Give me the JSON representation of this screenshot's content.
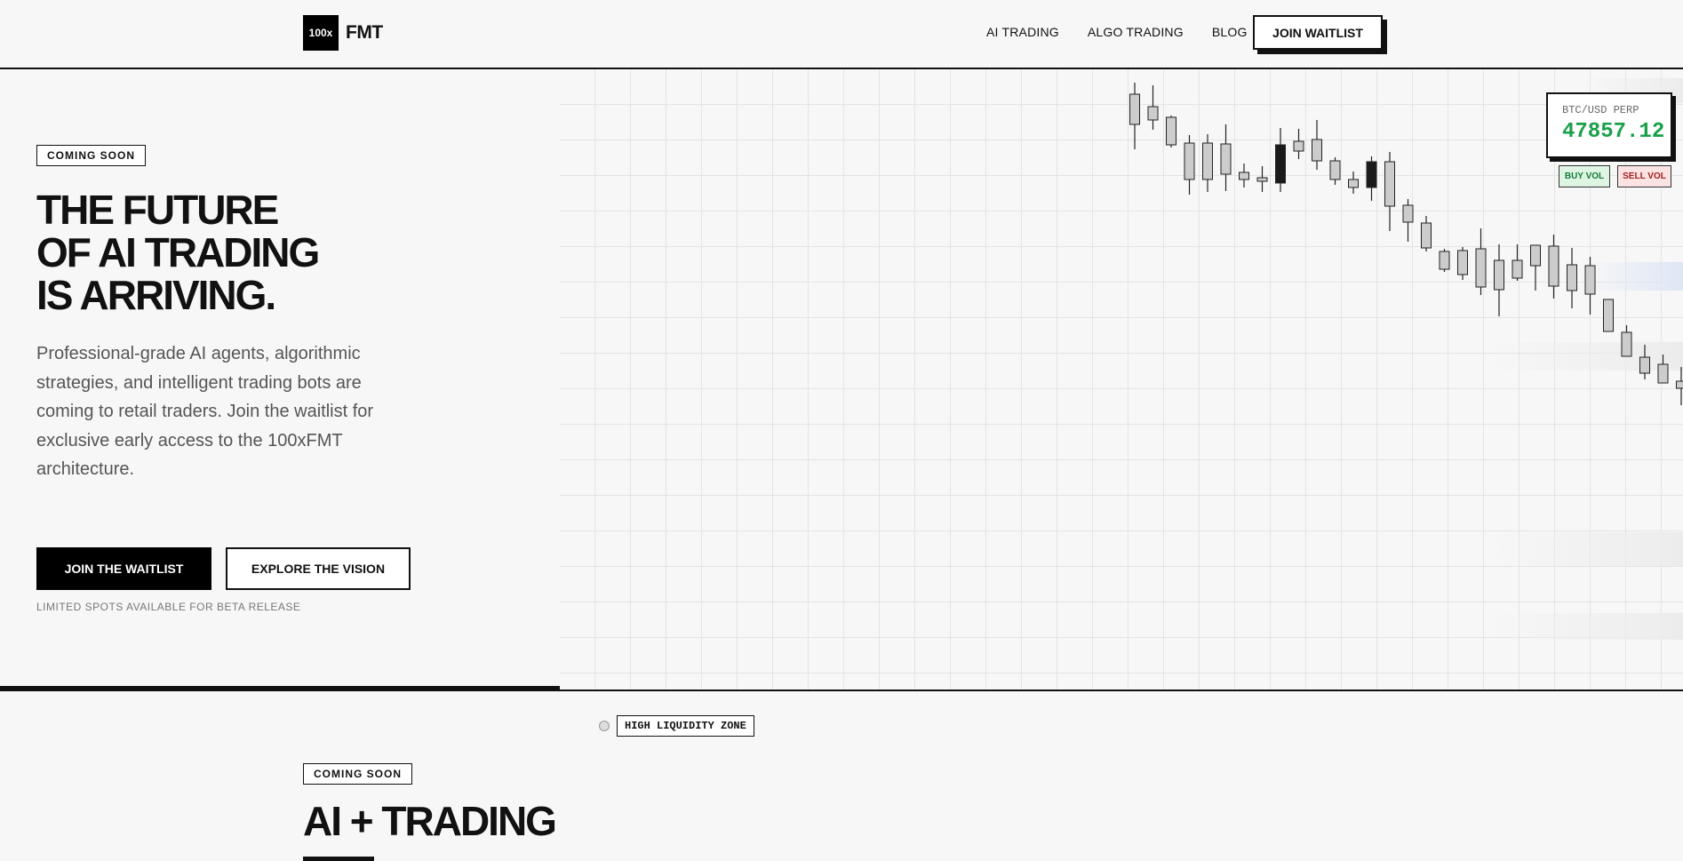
{
  "header": {
    "logo_mark": "100x",
    "logo_text": "FMT",
    "nav": [
      "AI TRADING",
      "ALGO TRADING",
      "BLOG"
    ],
    "cta": "JOIN WAITLIST"
  },
  "hero": {
    "badge": "COMING SOON",
    "title_lines": [
      "THE FUTURE",
      "OF AI TRADING",
      "IS ARRIVING."
    ],
    "description": "Professional-grade AI agents, algorithmic strategies, and intelligent trading bots are coming to retail traders. Join the waitlist for exclusive early access to the 100xFMT architecture.",
    "primary_button": "JOIN THE WAITLIST",
    "secondary_button": "EXPLORE THE VISION",
    "note": "LIMITED SPOTS AVAILABLE FOR BETA RELEASE"
  },
  "ticker": {
    "pair": "BTC/USD PERP",
    "price": "47857.12",
    "price_color": "#1aa04a",
    "buy_label": "BUY VOL",
    "sell_label": "SELL VOL"
  },
  "liquidity_label": "HIGH LIQUIDITY ZONE",
  "section2": {
    "badge": "COMING SOON",
    "title": "AI + TRADING"
  },
  "chart_data": {
    "type": "candlestick",
    "candles": [
      {
        "o": 62,
        "c": 28,
        "h": 75,
        "l": 0
      },
      {
        "o": 48,
        "c": 33,
        "h": 72,
        "l": 22
      },
      {
        "o": 36,
        "c": 5,
        "h": 38,
        "l": 2
      },
      {
        "o": 7,
        "c": -34,
        "h": 16,
        "l": -51
      },
      {
        "o": 7,
        "c": -34,
        "h": 17,
        "l": -48
      },
      {
        "o": 6,
        "c": -28,
        "h": 28,
        "l": -47
      },
      {
        "o": -26,
        "c": -34,
        "h": -16,
        "l": -43
      },
      {
        "o": -32,
        "c": -36,
        "h": -19,
        "l": -48
      },
      {
        "o": -38,
        "c": 5,
        "h": 24,
        "l": -48
      },
      {
        "o": 9,
        "c": -2,
        "h": 23,
        "l": -11
      },
      {
        "o": 11,
        "c": -13,
        "h": 33,
        "l": -23
      },
      {
        "o": -13,
        "c": -34,
        "h": -9,
        "l": -40
      },
      {
        "o": -34,
        "c": -43,
        "h": -25,
        "l": -50
      },
      {
        "o": -43,
        "c": -14,
        "h": -8,
        "l": -58
      },
      {
        "o": -14,
        "c": -64,
        "h": -3,
        "l": -92
      },
      {
        "o": -63,
        "c": -82,
        "h": -56,
        "l": -104
      },
      {
        "o": -83,
        "c": -111,
        "h": -75,
        "l": -115
      },
      {
        "o": -115,
        "c": -135,
        "h": -112,
        "l": -138
      },
      {
        "o": -114,
        "c": -141,
        "h": -110,
        "l": -147
      },
      {
        "o": -112,
        "c": -155,
        "h": -89,
        "l": -164
      },
      {
        "o": -125,
        "c": -158,
        "h": -107,
        "l": -188
      },
      {
        "o": -125,
        "c": -145,
        "h": -107,
        "l": -148
      },
      {
        "o": -108,
        "c": -131,
        "h": -108,
        "l": -159
      },
      {
        "o": -109,
        "c": -154,
        "h": -96,
        "l": -168
      },
      {
        "o": -130,
        "c": -159,
        "h": -111,
        "l": -179
      },
      {
        "o": -131,
        "c": -163,
        "h": -121,
        "l": -186
      },
      {
        "o": -169,
        "c": -205,
        "h": -169,
        "l": -205
      },
      {
        "o": -206,
        "c": -233,
        "h": -198,
        "l": -233
      },
      {
        "o": -234,
        "c": -252,
        "h": -220,
        "l": -259
      },
      {
        "o": -242,
        "c": -263,
        "h": -231,
        "l": -263
      },
      {
        "o": -261,
        "c": -269,
        "h": -245,
        "l": -288
      }
    ]
  }
}
